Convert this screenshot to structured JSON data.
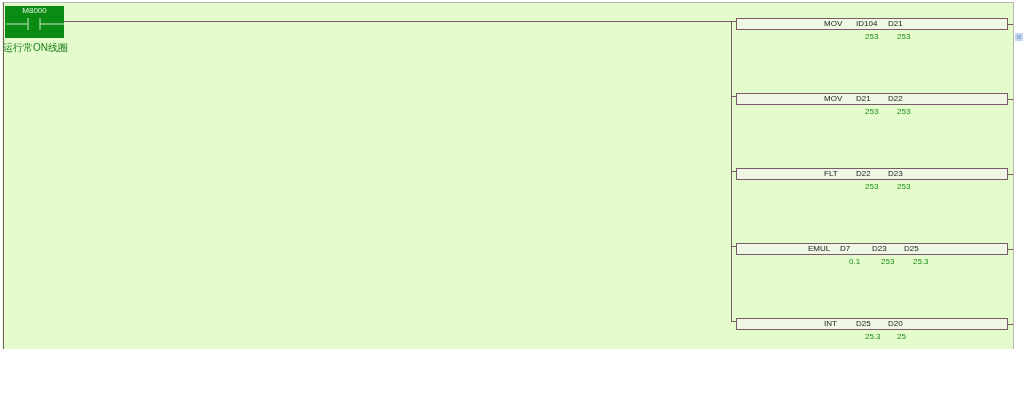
{
  "contact": {
    "device": "M8000",
    "comment": "运行常ON线圈"
  },
  "instructions": [
    {
      "operands": [
        "MOV",
        "ID104",
        "D21"
      ],
      "values": [
        "253",
        "253"
      ]
    },
    {
      "operands": [
        "MOV",
        "D21",
        "D22"
      ],
      "values": [
        "253",
        "253"
      ]
    },
    {
      "operands": [
        "FLT",
        "D22",
        "D23"
      ],
      "values": [
        "253",
        "253"
      ]
    },
    {
      "operands": [
        "EMUL",
        "D7",
        "D23",
        "D25"
      ],
      "values": [
        "0.1",
        "253",
        "25.3"
      ]
    },
    {
      "operands": [
        "INT",
        "D25",
        "D20"
      ],
      "values": [
        "25.3",
        "25"
      ]
    }
  ]
}
